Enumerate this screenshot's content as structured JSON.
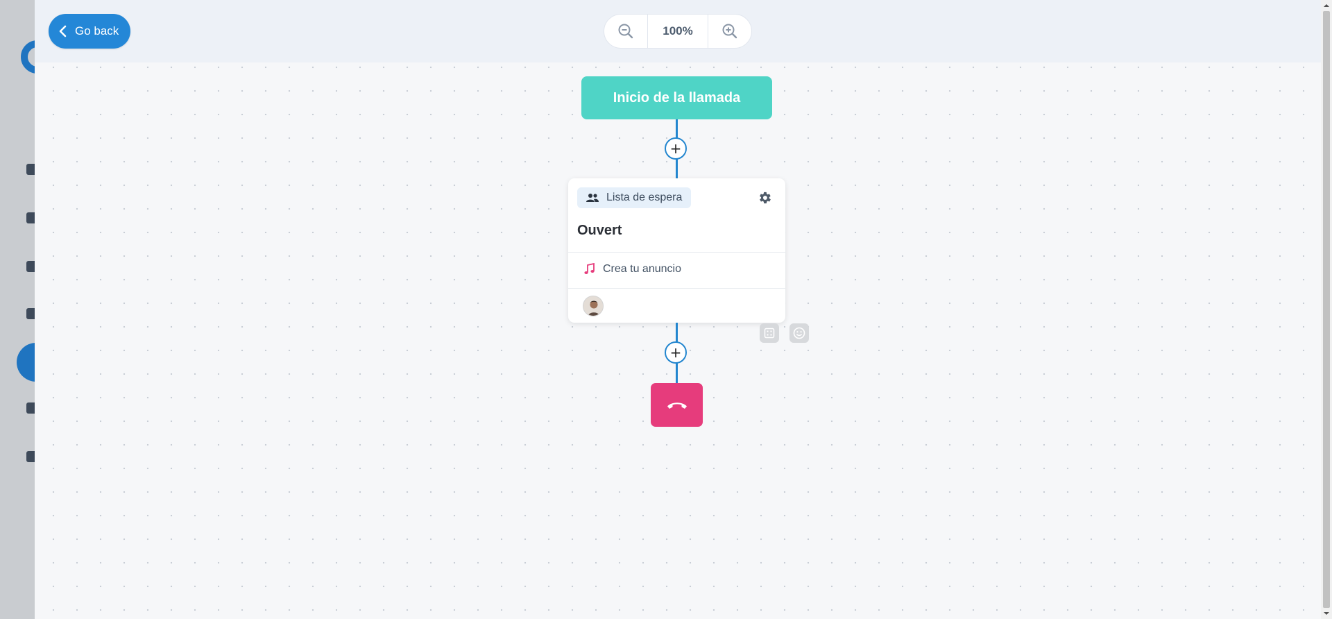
{
  "toolbar": {
    "go_back_label": "Go back",
    "zoom_value": "100%"
  },
  "flow": {
    "start_label": "Inicio de la llamada",
    "node": {
      "tag_label": "Lista de espera",
      "title": "Ouvert",
      "announcement_label": "Crea tu anuncio"
    },
    "add_step_symbol": "+"
  },
  "colors": {
    "accent": "#2487d7",
    "start_node": "#4fd4c6",
    "hangup": "#e63c7c",
    "connector": "#2386cf"
  },
  "icons": {
    "back": "chevron-left-icon",
    "zoom_out": "zoom-out-icon",
    "zoom_in": "zoom-in-icon",
    "tag": "group-icon",
    "settings": "gear-icon",
    "music": "music-note-icon",
    "hangup": "phone-hangup-icon"
  }
}
